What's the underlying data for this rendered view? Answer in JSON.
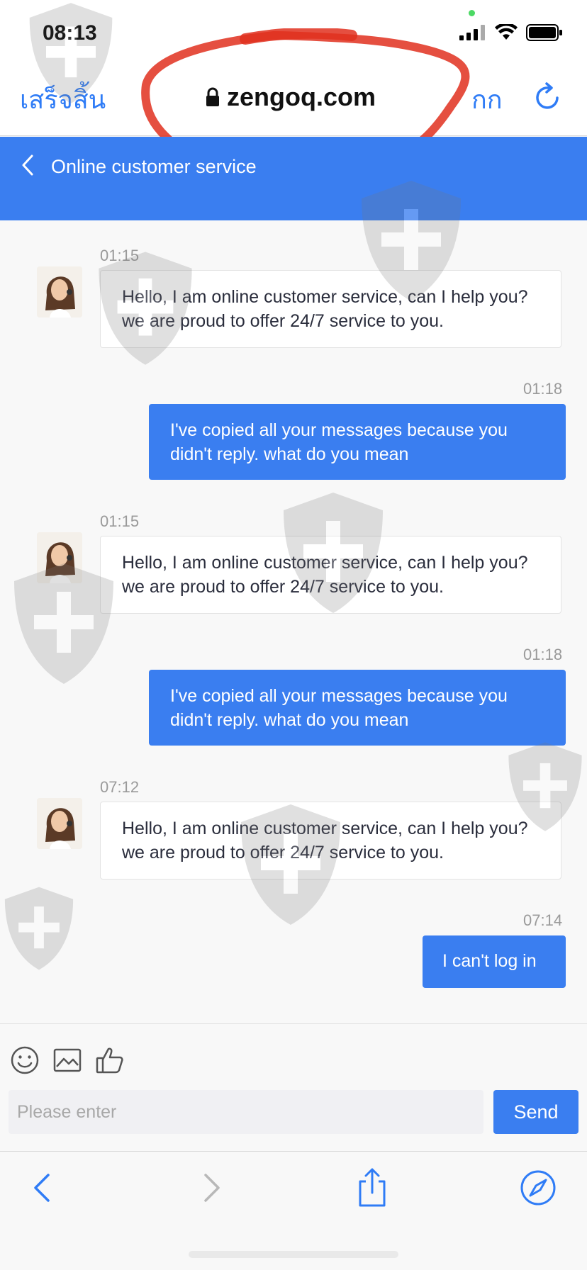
{
  "status_bar": {
    "time": "08:13",
    "icons": [
      "signal-icon",
      "wifi-icon",
      "battery-icon"
    ]
  },
  "browser": {
    "done_label": "เสร็จสิ้น",
    "url": "zengoq.com",
    "text_size_label": "กก",
    "accent_color": "#2f7cf6"
  },
  "header": {
    "title": "Online customer service",
    "color": "#3a7ef0"
  },
  "messages": [
    {
      "side": "agent",
      "time": "01:15",
      "text": "Hello, I am online customer service, can I help you? we are proud to offer 24/7 service to you."
    },
    {
      "side": "user",
      "time": "01:18",
      "text": "I've copied all your messages because you didn't reply. what do you mean"
    },
    {
      "side": "agent",
      "time": "01:15",
      "text": "Hello, I am online customer service, can I help you? we are proud to offer 24/7 service to you."
    },
    {
      "side": "user",
      "time": "01:18",
      "text": "I've copied all your messages because you didn't reply. what do you mean"
    },
    {
      "side": "agent",
      "time": "07:12",
      "text": "Hello, I am online customer service, can I help you? we are proud to offer 24/7 service to you."
    },
    {
      "side": "user",
      "time": "07:14",
      "text": "I can't log in"
    }
  ],
  "composer": {
    "placeholder": "Please enter",
    "value": "",
    "send_label": "Send",
    "tools": [
      "emoji-icon",
      "image-icon",
      "thumbs-up-icon"
    ]
  },
  "toolbar": {
    "buttons": [
      "back-icon",
      "forward-icon",
      "share-icon",
      "compass-icon"
    ]
  }
}
